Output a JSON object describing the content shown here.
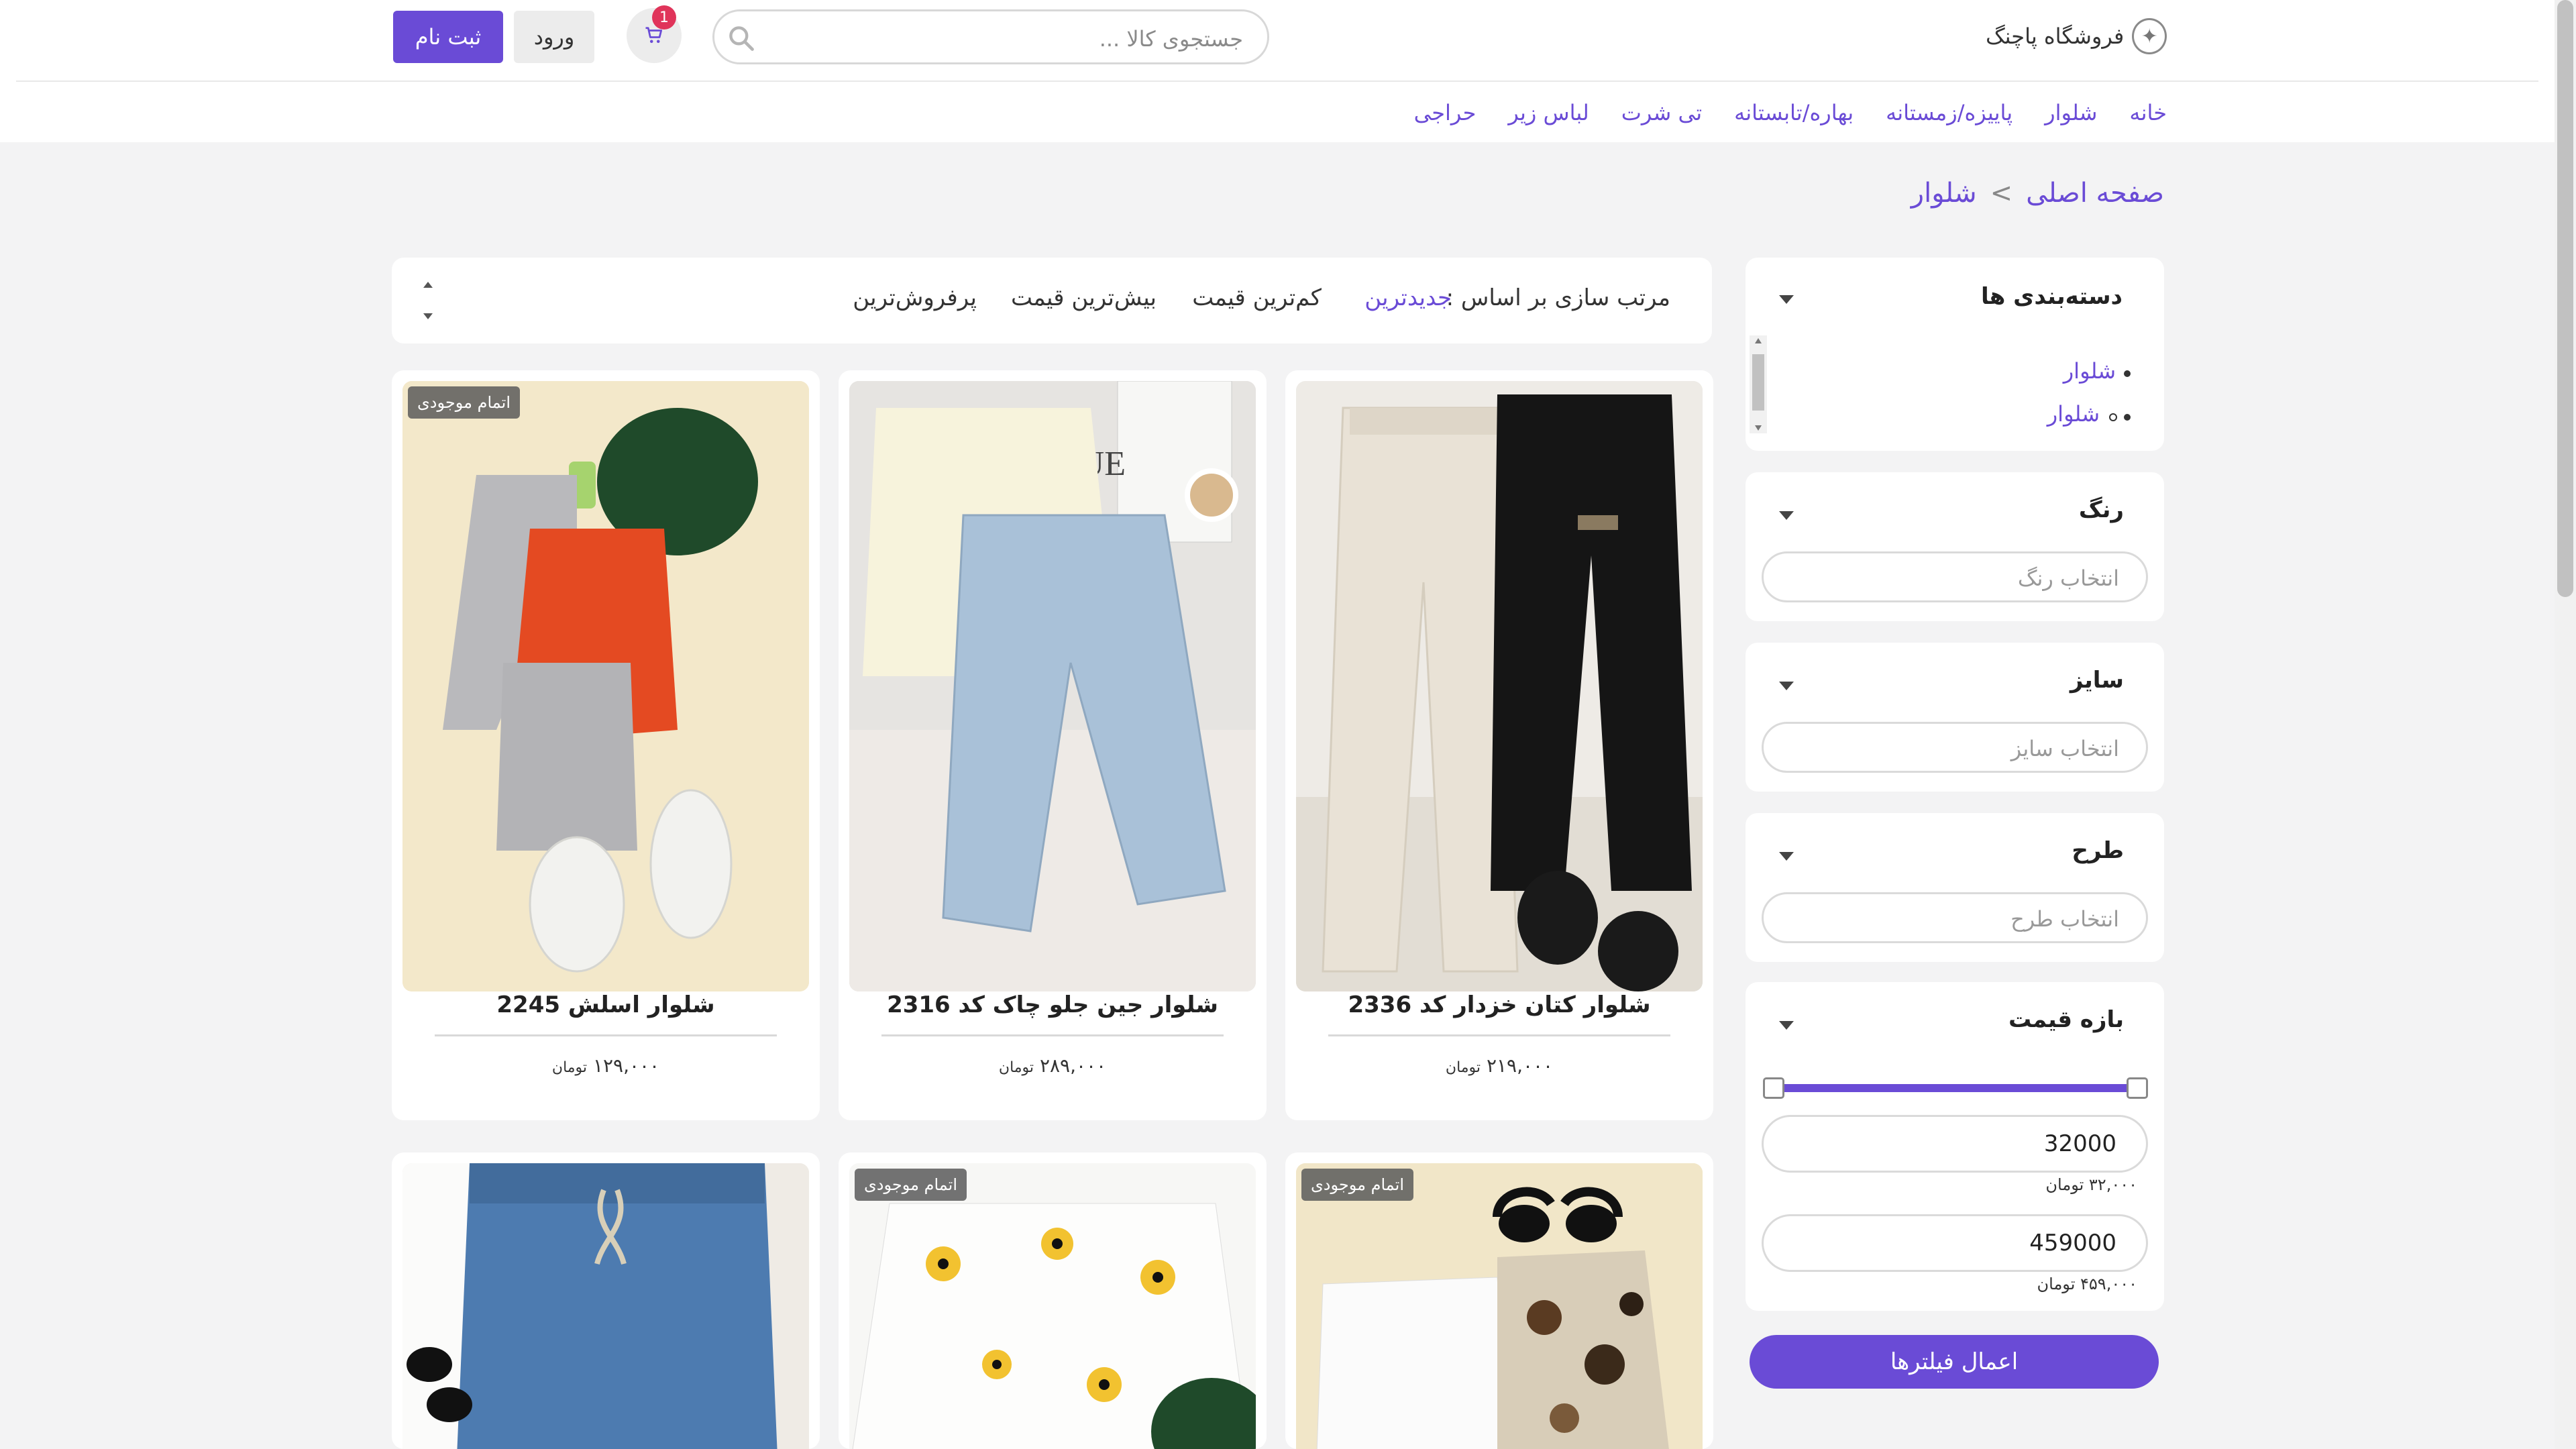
{
  "brand": {
    "name": "فروشگاه پاچنگ",
    "logo_icon": "kite-logo-icon"
  },
  "search": {
    "placeholder": "جستجوی کالا ..."
  },
  "cart": {
    "count": "1"
  },
  "auth": {
    "login": "ورود",
    "signup": "ثبت نام"
  },
  "nav": [
    "خانه",
    "شلوار",
    "پاییزه/زمستانه",
    "بهاره/تابستانه",
    "تی شرت",
    "لباس زیر",
    "حراجی"
  ],
  "breadcrumb": {
    "home": "صفحه اصلی",
    "separator": ">",
    "current": "شلوار"
  },
  "filters": {
    "categories": {
      "title": "دسته‌بندی ها",
      "items": [
        "شلوار",
        "شلوار"
      ]
    },
    "color": {
      "title": "رنگ",
      "placeholder": "انتخاب رنگ"
    },
    "size": {
      "title": "سایز",
      "placeholder": "انتخاب سایز"
    },
    "pattern": {
      "title": "طرح",
      "placeholder": "انتخاب طرح"
    },
    "price": {
      "title": "بازه قیمت",
      "min": "32000",
      "min_caption": "۳۲,۰۰۰ تومان",
      "max": "459000",
      "max_caption": "۴۵۹,۰۰۰ تومان",
      "slider_min_fraction": 0,
      "slider_max_fraction": 1
    },
    "apply": "اعمال فیلترها"
  },
  "sort": {
    "label": "مرتب سازی بر اساس :",
    "options": [
      "جدیدترین",
      "کم‌ترین قیمت",
      "بیش‌ترین قیمت",
      "پرفروش‌ترین"
    ],
    "active": "جدیدترین"
  },
  "products": [
    {
      "title": "شلوار کتان خزدار کد 2336",
      "price": "۲۱۹,۰۰۰",
      "currency": "تومان",
      "badge": ""
    },
    {
      "title": "شلوار جین جلو چاک کد 2316",
      "price": "۲۸۹,۰۰۰",
      "currency": "تومان",
      "badge": ""
    },
    {
      "title": "شلوار اسلش 2245",
      "price": "۱۲۹,۰۰۰",
      "currency": "تومان",
      "badge": "اتمام موجودی"
    },
    {
      "title": "",
      "price": "",
      "currency": "",
      "badge": "اتمام موجودی"
    },
    {
      "title": "",
      "price": "",
      "currency": "",
      "badge": "اتمام موجودی"
    },
    {
      "title": "",
      "price": "",
      "currency": "",
      "badge": ""
    }
  ],
  "colors": {
    "accent": "#6a4bd6",
    "badge_bg": "#5a5a5a",
    "cart_badge": "#e0345a"
  }
}
